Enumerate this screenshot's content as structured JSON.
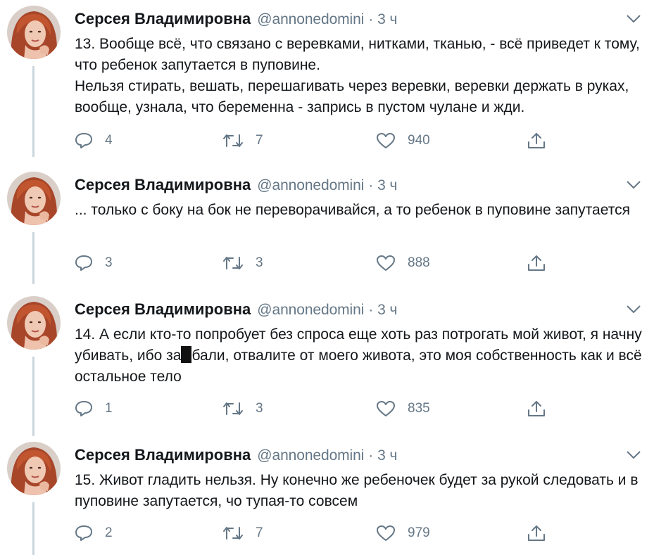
{
  "colors": {
    "text": "#14171a",
    "secondary": "#657786",
    "thread_line": "#ccd6dd",
    "redaction": "#111111"
  },
  "tweets": [
    {
      "author_name": "Серсея Владимировна",
      "handle": "@annonedomini",
      "separator": "·",
      "time": "3 ч",
      "lines": [
        "13. Вообще всё, что связано с веревками, нитками, тканью, - всё приведет к тому, что ребенок запутается в пуповине.",
        "Нельзя стирать, вешать, перешагивать через веревки, веревки держать в руках, вообще, узнала, что беременна - запрись в пустом чулане и жди."
      ],
      "replies": "4",
      "retweets": "7",
      "likes": "940"
    },
    {
      "author_name": "Серсея Владимировна",
      "handle": "@annonedomini",
      "separator": "·",
      "time": "3 ч",
      "lines": [
        "... только с боку на бок не переворачивайся, а то ребенок в пуповине запутается"
      ],
      "replies": "3",
      "retweets": "3",
      "likes": "888"
    },
    {
      "author_name": "Серсея Владимировна",
      "handle": "@annonedomini",
      "separator": "·",
      "time": "3 ч",
      "text_before_redaction": "14. А если кто-то попробует без спроса еще хоть раз потрогать мой живот, я начну убивать, ибо за",
      "text_after_redaction": "бали, отвалите от моего живота, это моя собственность как и всё остальное тело",
      "replies": "1",
      "retweets": "3",
      "likes": "835"
    },
    {
      "author_name": "Серсея Владимировна",
      "handle": "@annonedomini",
      "separator": "·",
      "time": "3 ч",
      "lines": [
        "15. Живот гладить нельзя. Ну конечно же ребеночек будет за рукой следовать и в пуповине запутается, чо тупая-то совсем"
      ],
      "replies": "2",
      "retweets": "7",
      "likes": "979"
    }
  ]
}
